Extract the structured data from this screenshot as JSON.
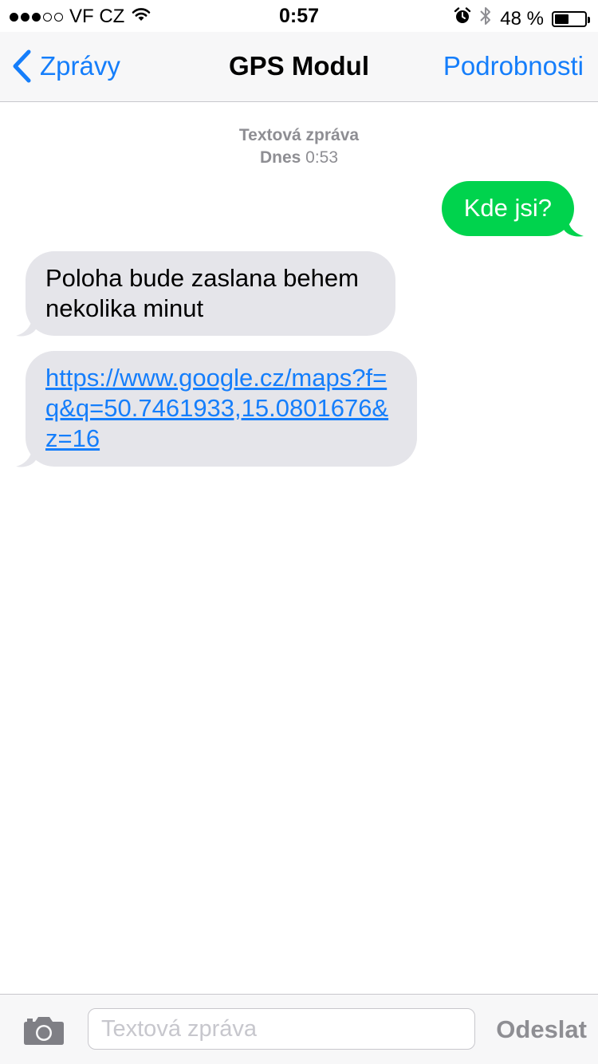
{
  "status_bar": {
    "signal_filled": 3,
    "signal_total": 5,
    "carrier": "VF CZ",
    "time": "0:57",
    "battery_text": "48 %",
    "battery_level": 0.48,
    "icons": [
      "signal-icon",
      "wifi-icon",
      "alarm-icon",
      "bluetooth-icon",
      "battery-icon"
    ]
  },
  "nav": {
    "back_label": "Zprávy",
    "title": "GPS Modul",
    "details_label": "Podrobnosti",
    "accent_color": "#157efb"
  },
  "conversation": {
    "meta_type": "Textová zpráva",
    "meta_day": "Dnes",
    "meta_time": "0:53",
    "messages": [
      {
        "direction": "outgoing",
        "text": "Kde jsi?",
        "color": "#00d34d"
      },
      {
        "direction": "incoming",
        "text": "Poloha bude zaslana behem nekolika minut",
        "color": "#e5e5ea"
      },
      {
        "direction": "incoming",
        "text": "https://www.google.cz/maps?f=q&q=50.7461933,15.0801676&z=16",
        "is_link": true,
        "color": "#e5e5ea"
      }
    ]
  },
  "input_bar": {
    "placeholder": "Textová zpráva",
    "value": "",
    "send_label": "Odeslat",
    "camera_icon": "camera-icon"
  }
}
